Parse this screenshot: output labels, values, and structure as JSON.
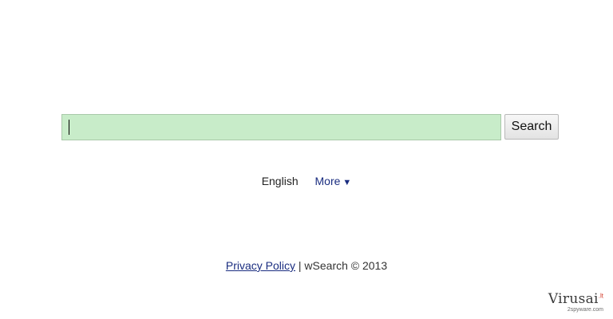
{
  "search": {
    "value": "",
    "button_label": "Search"
  },
  "language": {
    "current": "English",
    "more_label": "More",
    "more_arrow": "▼"
  },
  "footer": {
    "privacy_label": "Privacy Policy",
    "separator": " | ",
    "copyright": "wSearch © 2013"
  },
  "watermark": {
    "main": "Virusai",
    "tld": ".lt",
    "sub": "2spyware.com"
  },
  "colors": {
    "input_background": "#c8ecc9",
    "link": "#1a2d80",
    "watermark_accent": "#d23b2a"
  }
}
